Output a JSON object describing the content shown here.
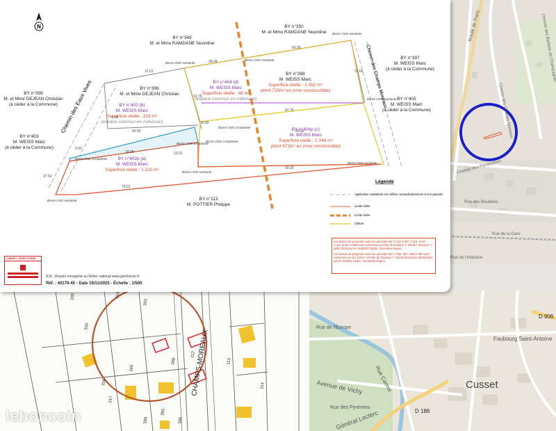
{
  "survey": {
    "north_label": "N",
    "parcels": [
      {
        "id": "p349",
        "lines": [
          "BY n°349",
          "M. et Mme RAMDANE Nourdine"
        ],
        "color": "#222"
      },
      {
        "id": "p350",
        "lines": [
          "BY n°350",
          "M. et Mme RAMDANE Nourdine"
        ],
        "color": "#222"
      },
      {
        "id": "p396",
        "lines": [
          "BY n°396",
          "M. et Mme DEJEAN Christian"
        ],
        "color": "#222"
      },
      {
        "id": "p398",
        "lines": [
          "BY n°398",
          "M. WEISS Marc",
          "Superficie réelle : 2 082 m²",
          "(dont 715m² en zone constructible)"
        ],
        "color": "#222"
      },
      {
        "id": "p397",
        "lines": [
          "BY n°397",
          "M. WEISS Marc",
          "(à céder à la Commune)"
        ],
        "color": "#222"
      },
      {
        "id": "p405",
        "lines": [
          "BY n°405",
          "M. WEISS Marc",
          "(à céder à la Commune)"
        ],
        "color": "#222"
      },
      {
        "id": "p399",
        "lines": [
          "BY n°399",
          "M. et Mme DEJEAN Christian",
          "(à céder à la Commune)"
        ],
        "color": "#222"
      },
      {
        "id": "p403",
        "lines": [
          "BY n°403",
          "M. WEISS Marc",
          "(à céder à la Commune)"
        ],
        "color": "#222"
      },
      {
        "id": "p113",
        "lines": [
          "BY n°113",
          "M. POTTIER Philippe"
        ],
        "color": "#222"
      },
      {
        "id": "p404d",
        "lines": [
          "BY n°404 (d)",
          "M. WEISS Marc",
          "Superficie réelle : 48 m²",
          "(espace commun en indivision)"
        ],
        "color": "#8b2fb5"
      },
      {
        "id": "p402b",
        "lines": [
          "BY n°402 (b)",
          "M. WEISS Marc",
          "Superficie réelle : 319 m²",
          "(espace commun en indivision)"
        ],
        "color": "#8b2fb5"
      },
      {
        "id": "p404c",
        "lines": [
          "BY n°404p (c)",
          "M. WEISS Marc",
          "Superficie réelle : 2 046 m²",
          "(dont 673m² en zone constructible)"
        ],
        "color": "#8b2fb5"
      },
      {
        "id": "p402a",
        "lines": [
          "BY n°402p (a)",
          "M. WEISS Marc",
          "Superficie réelle : 1 132 m²"
        ],
        "color": "#8b2fb5"
      }
    ],
    "streets": [
      "Chemin des Eaux Vives",
      "Chemin des Champs Moreaux"
    ],
    "bornes": [
      "Borne OGE existante",
      "Borne OGE à implanter"
    ],
    "dimensions": [
      "12.01",
      "28.09",
      "60.36",
      "37.65",
      "13.75",
      "10.00",
      "47.75",
      "60.66",
      "76.01",
      "93.20",
      "18.68",
      "50.50",
      "9.92",
      "6.58",
      "37.63",
      "10.01"
    ],
    "legend": {
      "title": "Légende",
      "items": [
        "Application cadastrale non définie contradictoirement et non garantie",
        "Limite réelle",
        "Limite réelle",
        "Clôture"
      ]
    },
    "notes": [
      "Les limites de propriété entre les parcelles BY n°112 et BY n°113, et BY n°112 et BY n°396 sont conformes au Plan de Division n° 98-617 dressé le 7 juillet 2006 par M. HUBERT Didier, Géomètre-Expert.",
      "Les limites de propriété entre les parcelles BY n°396, 397, 398 et 399 sont conformes au DA 2149 Y et Plan de Division n° 40179 dressés le 05/02/2021 par M. ROBIN Cédric, Géomètre-Expert."
    ],
    "footer": {
      "company": "CABINET CEDRIC ROBIN",
      "dossier_note": "N.B.: Dossier enregistré au fichier national www.geofoncier.fr",
      "reference": "Réf. : 40179-45  -  Date 19/11/2025  -  Échelle : 1/500"
    }
  },
  "map_top": {
    "labels": [
      "Route de Paris",
      "Chemin des Champs Moreaux",
      "Chemin des Barbets de Champagnat",
      "Chemin des Pervenches",
      "Rue des Boulaires",
      "Rue de la Gare",
      "Rue de l'Industrie"
    ],
    "highlight_color": "#1a1fc7"
  },
  "map_bottom": {
    "labels": [
      "Cusset",
      "Faubourg Saint-Antoine",
      "Avenue de Vichy",
      "Rue Carnot",
      "D 186",
      "D 906",
      "Rue des Pyrénées",
      "Général Leclerc",
      "Rue de l'Europe"
    ]
  },
  "cadastre": {
    "street_label": "CHAMPS-MOREAUX",
    "parcel_numbers": [
      "335",
      "334",
      "316",
      "317",
      "319",
      "349",
      "350",
      "398",
      "112",
      "113",
      "114",
      "395",
      "396",
      "399"
    ],
    "circle_color": "#b5552d",
    "building_color": "#f2c12e"
  },
  "watermark": "leboncoin"
}
